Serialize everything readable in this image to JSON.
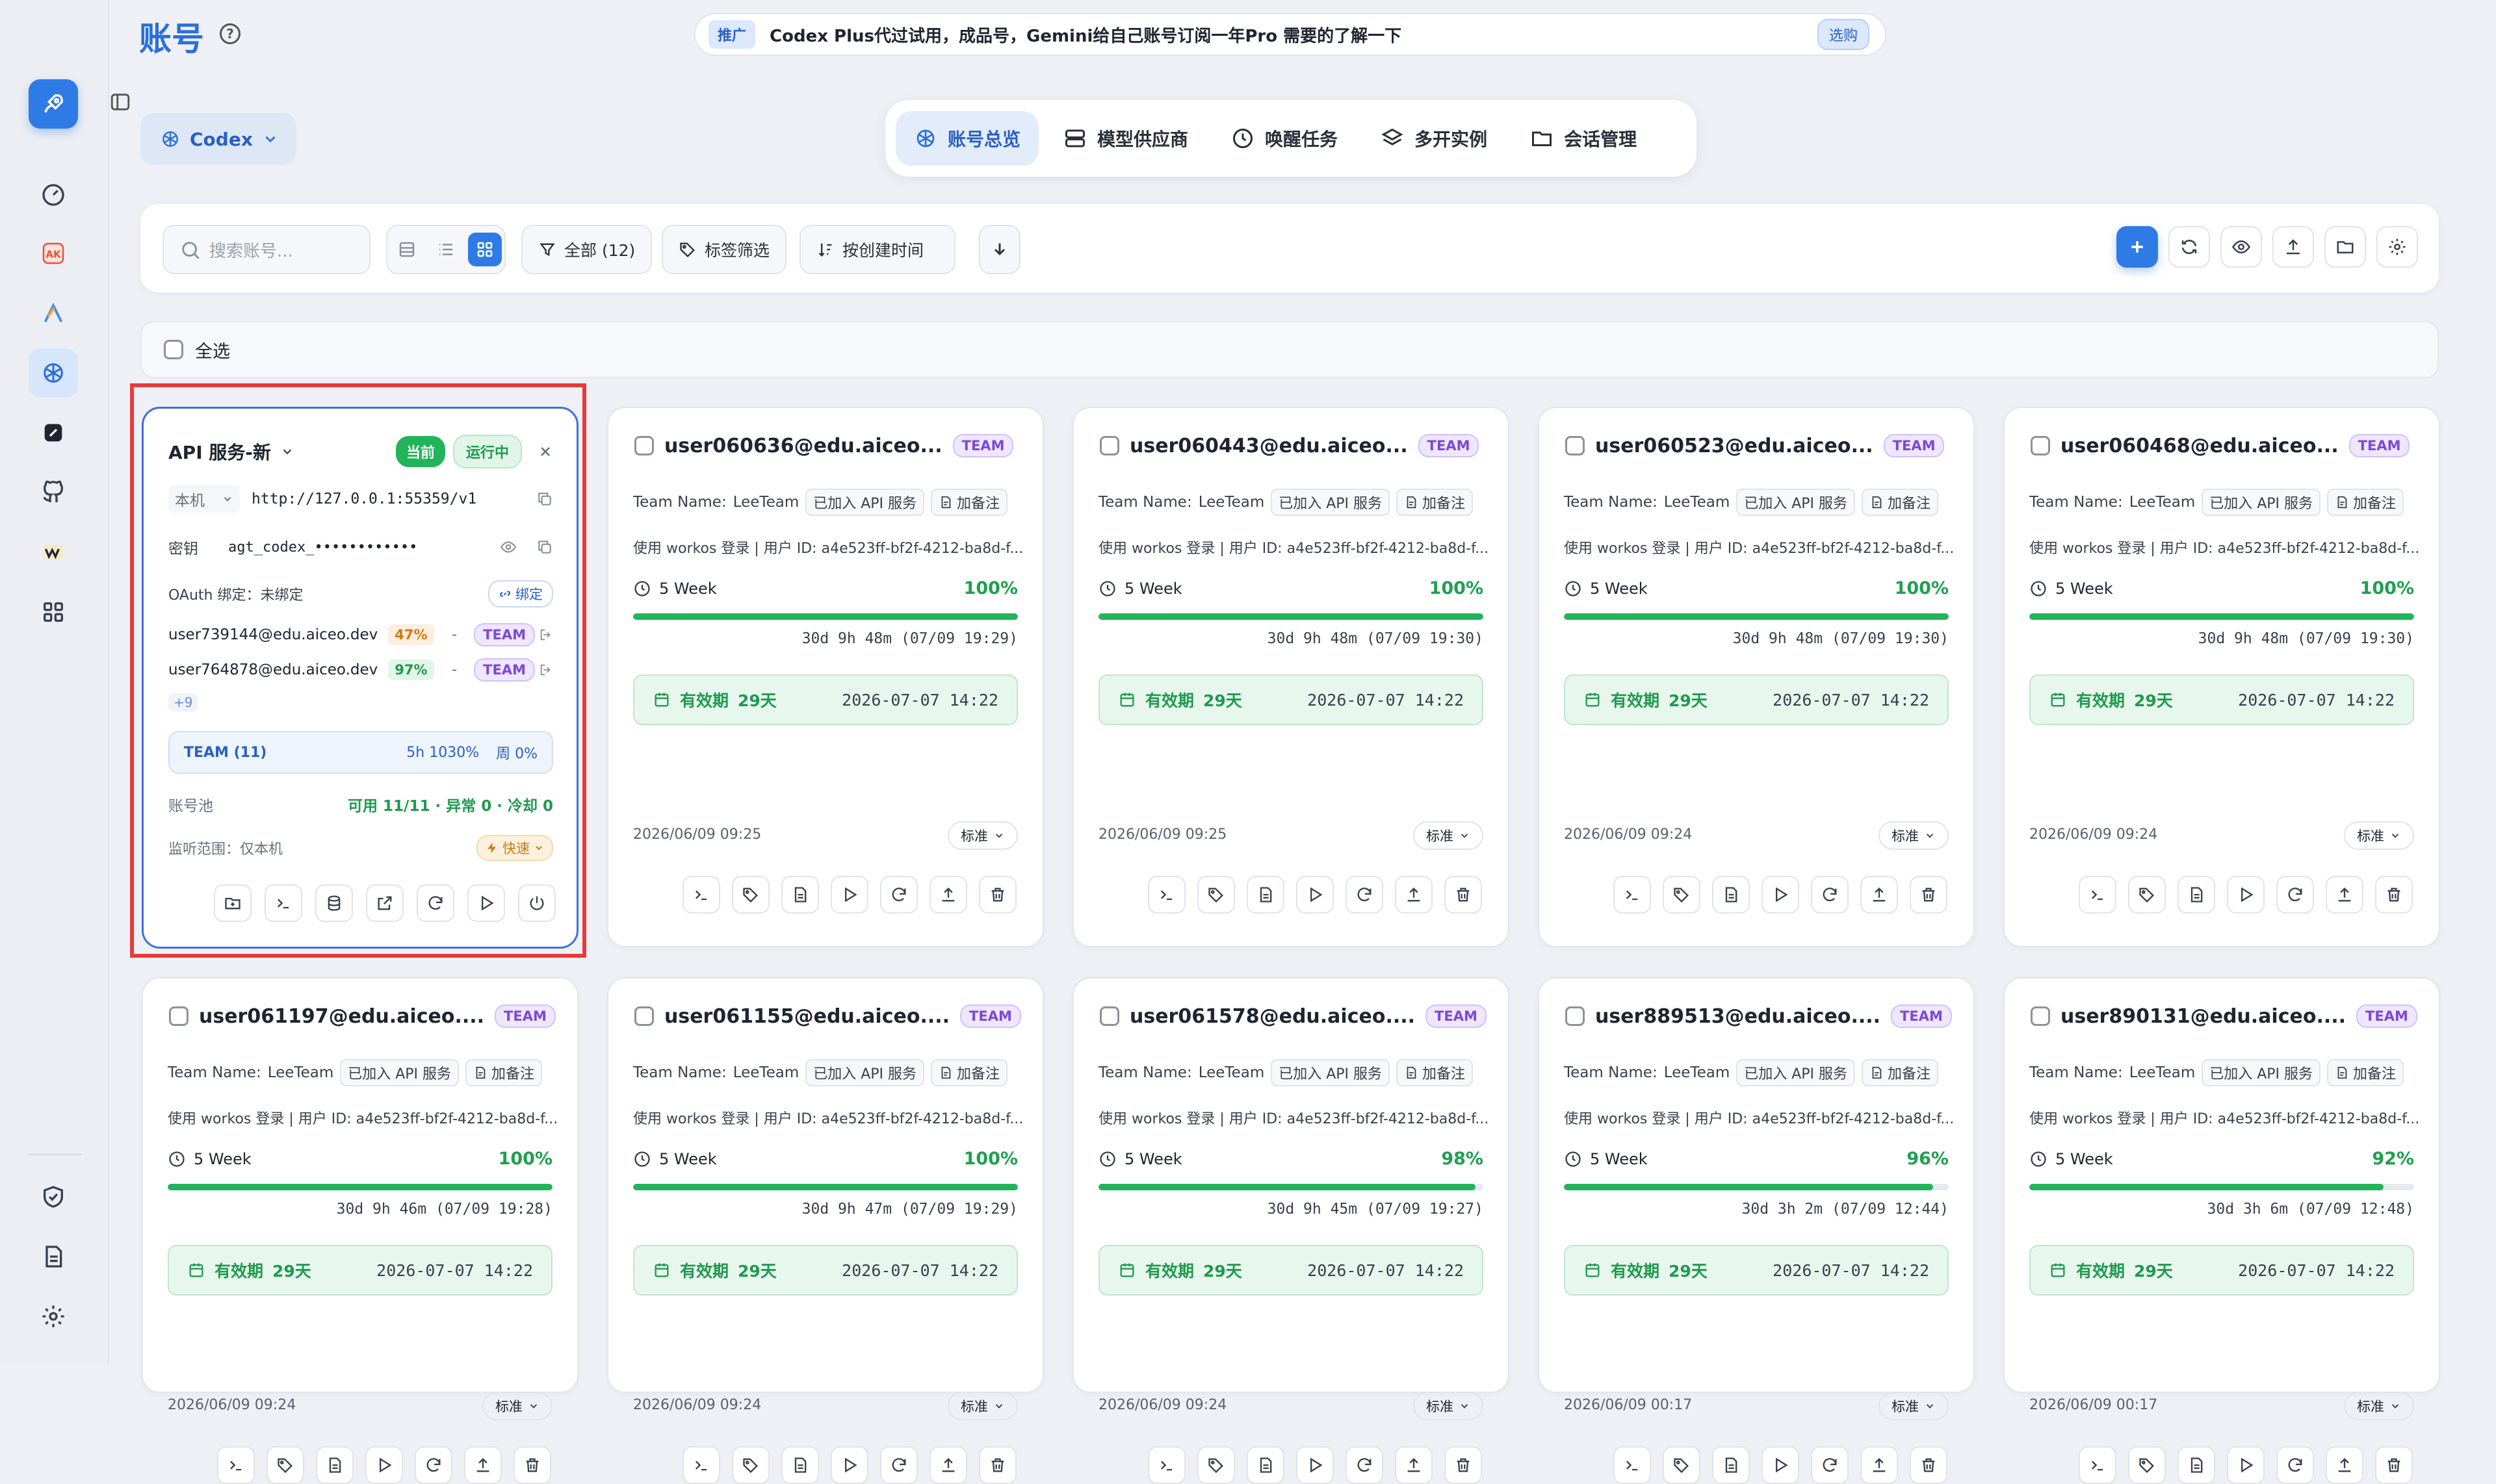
{
  "header": {
    "title": "账号",
    "promo_tag": "推广",
    "promo_text": "Codex Plus代过试用，成品号，Gemini给自己账号订阅一年Pro 需要的了解一下",
    "promo_button": "选购",
    "platform_label": "Codex"
  },
  "tabs": [
    {
      "label": "账号总览",
      "icon": "openai-icon",
      "active": true
    },
    {
      "label": "模型供应商",
      "icon": "server-icon",
      "active": false
    },
    {
      "label": "唤醒任务",
      "icon": "clock-icon",
      "active": false
    },
    {
      "label": "多开实例",
      "icon": "layers-icon",
      "active": false
    },
    {
      "label": "会话管理",
      "icon": "folder-icon",
      "active": false
    }
  ],
  "toolbar": {
    "search_placeholder": "搜索账号...",
    "filter_all": "全部 (12)",
    "tag_filter": "标签筛选",
    "sort_label": "按创建时间"
  },
  "select_all_label": "全选",
  "api_card": {
    "title": "API 服务-新",
    "badge_current": "当前",
    "badge_running": "运行中",
    "scope_select": "本机",
    "url": "http://127.0.0.1:55359/v1",
    "key_label": "密钥",
    "key_value": "agt_codex_••••••••••••",
    "oauth_label": "OAuth 绑定：未绑定",
    "bind_button": "绑定",
    "members": [
      {
        "email": "user739144@edu.aiceo.dev",
        "pct": "47%",
        "dash": "-",
        "team": "TEAM",
        "pct_level": "warn"
      },
      {
        "email": "user764878@edu.aiceo.dev",
        "pct": "97%",
        "dash": "-",
        "team": "TEAM",
        "pct_level": "ok"
      }
    ],
    "more_count": "+9",
    "team_summary": "TEAM (11)",
    "team_5h": "5h 1030%",
    "team_week": "周 0%",
    "pool_label": "账号池",
    "pool_value": "可用 11/11 · 异常 0 · 冷却 0",
    "listen_label": "监听范围：仅本机",
    "speed_button": "快速"
  },
  "card_common": {
    "team_tag": "TEAM",
    "team_name_label": "Team Name:",
    "team_name": "LeeTeam",
    "api_chip": "已加入 API 服务",
    "note_chip": "加备注",
    "desc": "使用 workos 登录 | 用户 ID: a4e523ff-bf2f-4212-ba8d-f...",
    "window_label": "5 Week",
    "expiry_label": "有效期",
    "expiry_days": "29天",
    "expiry_date": "2026-07-07 14:22",
    "std_label": "标准"
  },
  "accounts": [
    {
      "email": "user060636@edu.aiceo...",
      "pct": "100%",
      "level": 1.0,
      "reset": "30d 9h 48m (07/09 19:29)",
      "created": "2026/06/09 09:25"
    },
    {
      "email": "user060443@edu.aiceo...",
      "pct": "100%",
      "level": 1.0,
      "reset": "30d 9h 48m (07/09 19:30)",
      "created": "2026/06/09 09:25"
    },
    {
      "email": "user060523@edu.aiceo...",
      "pct": "100%",
      "level": 1.0,
      "reset": "30d 9h 48m (07/09 19:30)",
      "created": "2026/06/09 09:24"
    },
    {
      "email": "user060468@edu.aiceo...",
      "pct": "100%",
      "level": 1.0,
      "reset": "30d 9h 48m (07/09 19:30)",
      "created": "2026/06/09 09:24"
    },
    {
      "email": "user061197@edu.aiceo....",
      "pct": "100%",
      "level": 1.0,
      "reset": "30d 9h 46m (07/09 19:28)",
      "created": "2026/06/09 09:24"
    },
    {
      "email": "user061155@edu.aiceo....",
      "pct": "100%",
      "level": 1.0,
      "reset": "30d 9h 47m (07/09 19:29)",
      "created": "2026/06/09 09:24"
    },
    {
      "email": "user061578@edu.aiceo....",
      "pct": "98%",
      "level": 0.98,
      "reset": "30d 9h 45m (07/09 19:27)",
      "created": "2026/06/09 09:24"
    },
    {
      "email": "user889513@edu.aiceo....",
      "pct": "96%",
      "level": 0.96,
      "reset": "30d 3h 2m (07/09 12:44)",
      "created": "2026/06/09 00:17"
    },
    {
      "email": "user890131@edu.aiceo....",
      "pct": "92%",
      "level": 0.92,
      "reset": "30d 3h 6m (07/09 12:48)",
      "created": "2026/06/09 00:17"
    }
  ],
  "colors": {
    "accent": "#2f7be6",
    "success": "#22b45a",
    "team": "#7b49d6",
    "highlight": "#e53b3b"
  }
}
